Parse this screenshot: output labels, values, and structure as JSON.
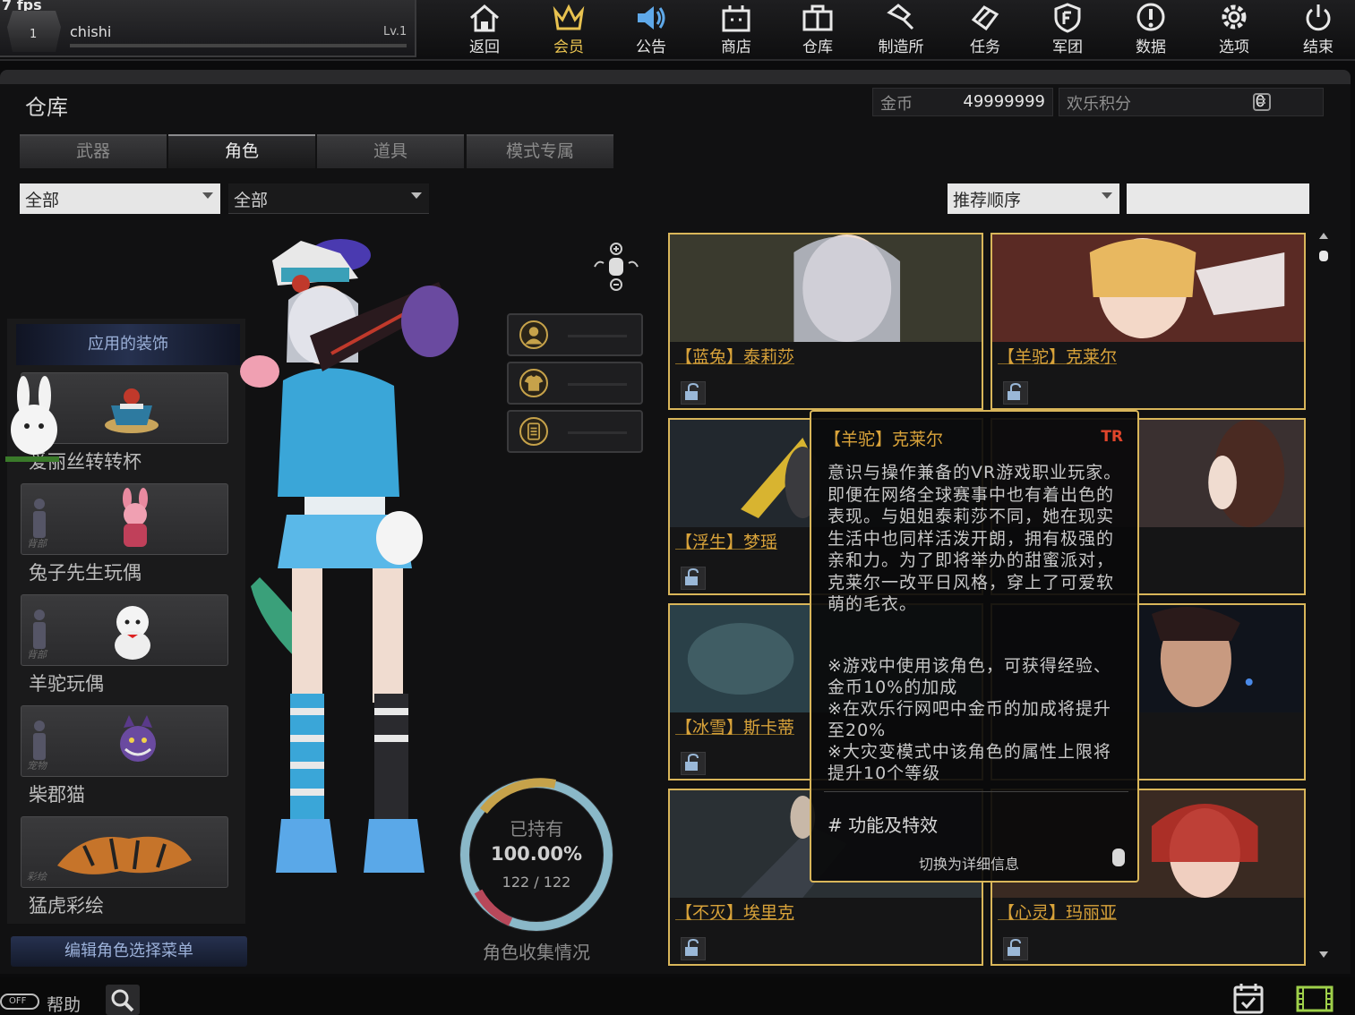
{
  "player": {
    "fps": "7 fps",
    "rank": "1",
    "name": "chishi",
    "level": "Lv.1"
  },
  "nav": [
    {
      "label": "返回",
      "icon": "home-icon"
    },
    {
      "label": "会员",
      "icon": "crown-icon"
    },
    {
      "label": "公告",
      "icon": "speaker-icon"
    },
    {
      "label": "商店",
      "icon": "shop-icon"
    },
    {
      "label": "仓库",
      "icon": "briefcase-icon"
    },
    {
      "label": "制造所",
      "icon": "hammer-icon"
    },
    {
      "label": "任务",
      "icon": "mission-icon"
    },
    {
      "label": "军团",
      "icon": "shield-icon"
    },
    {
      "label": "数据",
      "icon": "info-icon"
    },
    {
      "label": "选项",
      "icon": "gear-icon"
    },
    {
      "label": "结束",
      "icon": "power-icon"
    }
  ],
  "page_title": "仓库",
  "currency": {
    "gold_label": "金币",
    "gold_value": "49999999",
    "points_label": "欢乐积分",
    "points_value": "0"
  },
  "tabs": [
    "武器",
    "角色",
    "道具",
    "模式专属"
  ],
  "filters": {
    "filter1": "全部",
    "filter2": "全部",
    "sort": "推荐顺序",
    "search_value": ""
  },
  "decorations": {
    "header": "应用的装饰",
    "items": [
      {
        "name": "爱丽丝转转杯",
        "slot": ""
      },
      {
        "name": "兔子先生玩偶",
        "slot": "背部"
      },
      {
        "name": "羊驼玩偶",
        "slot": "背部"
      },
      {
        "name": "柴郡猫",
        "slot": "宠物"
      },
      {
        "name": "猛虎彩绘",
        "slot": "彩绘"
      }
    ],
    "edit_button": "编辑角色选择菜单"
  },
  "collection": {
    "own_label": "已持有",
    "percent": "100.00%",
    "count": "122 / 122",
    "label": "角色收集情况",
    "ratio": 1.0
  },
  "cards": [
    {
      "name": "【蓝兔】泰莉莎"
    },
    {
      "name": "【羊驼】克莱尔"
    },
    {
      "name": "【浮生】梦瑶"
    },
    {
      "name": ""
    },
    {
      "name": "【冰雪】斯卡蒂"
    },
    {
      "name": ""
    },
    {
      "name": "【不灭】埃里克"
    },
    {
      "name": "【心灵】玛丽亚"
    }
  ],
  "tooltip": {
    "title": "【羊驼】克莱尔",
    "badge": "TR",
    "description": "意识与操作兼备的VR游戏职业玩家。即便在网络全球赛事中也有着出色的表现。与姐姐泰莉莎不同，她在现实生活中也同样活泼开朗，拥有极强的亲和力。为了即将举办的甜蜜派对，克莱尔一改平日风格，穿上了可爱软萌的毛衣。",
    "bonus": "※游戏中使用该角色，可获得经验、金币10%的加成\n※在欢乐行网吧中金币的加成将提升至20%\n※大灾变模式中该角色的属性上限将提升10个等级",
    "section": "# 功能及特效",
    "switch_hint": "切换为详细信息"
  },
  "bottom": {
    "help_toggle": "OFF",
    "help_label": "帮助"
  },
  "colors": {
    "accent_gold": "#d9b65a",
    "name_orange": "#d9a33a",
    "tooltip_badge": "#e0452b",
    "deco_header": "#26314f"
  }
}
